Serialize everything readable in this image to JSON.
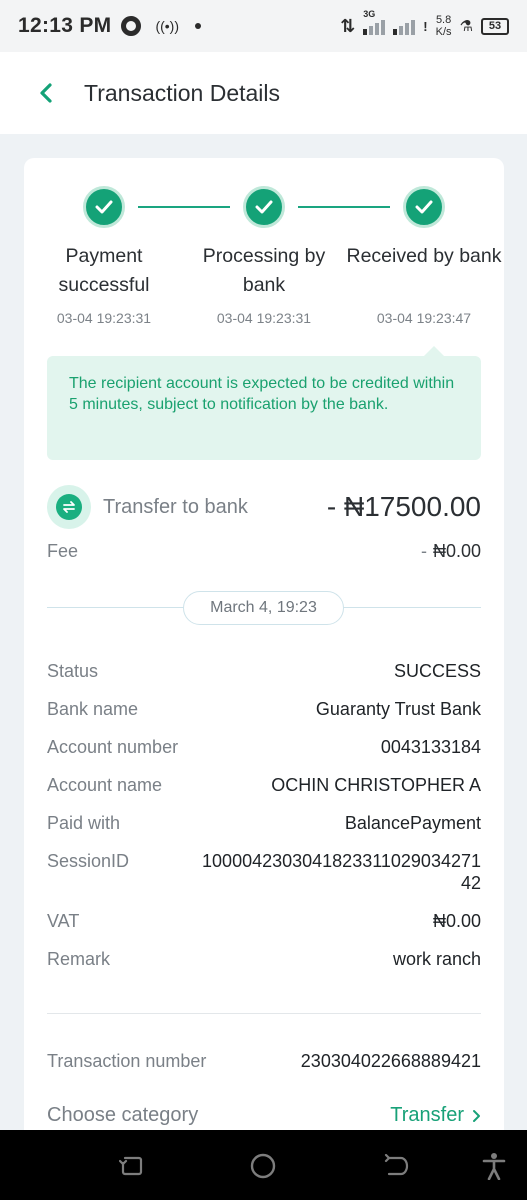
{
  "status_bar": {
    "time": "12:13 PM",
    "network_type": "3G",
    "speed_value": "5.8",
    "speed_unit": "K/s",
    "battery": "53"
  },
  "app_bar": {
    "title": "Transaction Details",
    "back_icon": "chevron-left-icon",
    "accent_color": "#14a277"
  },
  "steps": [
    {
      "label": "Payment successful",
      "time": "03-04 19:23:31"
    },
    {
      "label": "Processing by bank",
      "time": "03-04 19:23:31"
    },
    {
      "label": "Received by bank",
      "time": "03-04 19:23:47"
    }
  ],
  "notice": "The recipient account is expected to be credited within 5 minutes, subject to notification by the bank.",
  "transfer": {
    "label": "Transfer to bank",
    "amount": "- ₦17500.00",
    "icon": "transfer-arrows-icon"
  },
  "fee": {
    "label": "Fee",
    "dash": "-",
    "value": "₦0.00"
  },
  "date_divider": "March 4, 19:23",
  "details": [
    {
      "label": "Status",
      "value": "SUCCESS"
    },
    {
      "label": "Bank name",
      "value": "Guaranty Trust Bank"
    },
    {
      "label": "Account number",
      "value": "0043133184"
    },
    {
      "label": "Account name",
      "value": "OCHIN CHRISTOPHER A"
    },
    {
      "label": "Paid with",
      "value": "BalancePayment"
    },
    {
      "label": "SessionID",
      "value": "100004230304182331102903427142"
    },
    {
      "label": "VAT",
      "value": "₦0.00"
    },
    {
      "label": "Remark",
      "value": "work ranch"
    }
  ],
  "transaction_number": {
    "label": "Transaction number",
    "value": "230304022668889421"
  },
  "category": {
    "label": "Choose category",
    "value": "Transfer"
  },
  "nav_bar": [
    "recents-icon",
    "home-icon",
    "back-icon",
    "accessibility-icon"
  ]
}
